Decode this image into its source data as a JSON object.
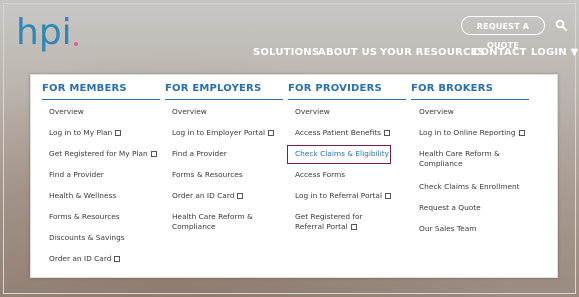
{
  "brand": {
    "logo_text": "hpi"
  },
  "header": {
    "quote_label": "REQUEST A QUOTE"
  },
  "nav": [
    "SOLUTIONS",
    "ABOUT US",
    "YOUR RESOURCES",
    "CONTACT",
    "LOGIN ▼"
  ],
  "menu": {
    "members": {
      "title": "FOR MEMBERS",
      "items": [
        "Overview",
        "Log in to My Plan",
        "Get Registered for My Plan",
        "Find a Provider",
        "Health & Wellness",
        "Forms & Resources",
        "Discounts & Savings",
        "Order an ID Card"
      ]
    },
    "employers": {
      "title": "FOR EMPLOYERS",
      "items": [
        "Overview",
        "Log in to Employer Portal",
        "Find a Provider",
        "Forms & Resources",
        "Order an ID Card",
        "Health Care Reform & Compliance"
      ]
    },
    "providers": {
      "title": "FOR PROVIDERS",
      "items": [
        "Overview",
        "Access Patient Benefits",
        "Check Claims & Eligibility",
        "Access Forms",
        "Log in to Referral Portal",
        "Get Registered for Referral Portal"
      ]
    },
    "brokers": {
      "title": "FOR BROKERS",
      "items": [
        "Overview",
        "Log in to Online Reporting",
        "Health Care Reform & Compliance",
        "Check Claims & Enrollment",
        "Request a Quote",
        "Our Sales Team"
      ]
    }
  }
}
